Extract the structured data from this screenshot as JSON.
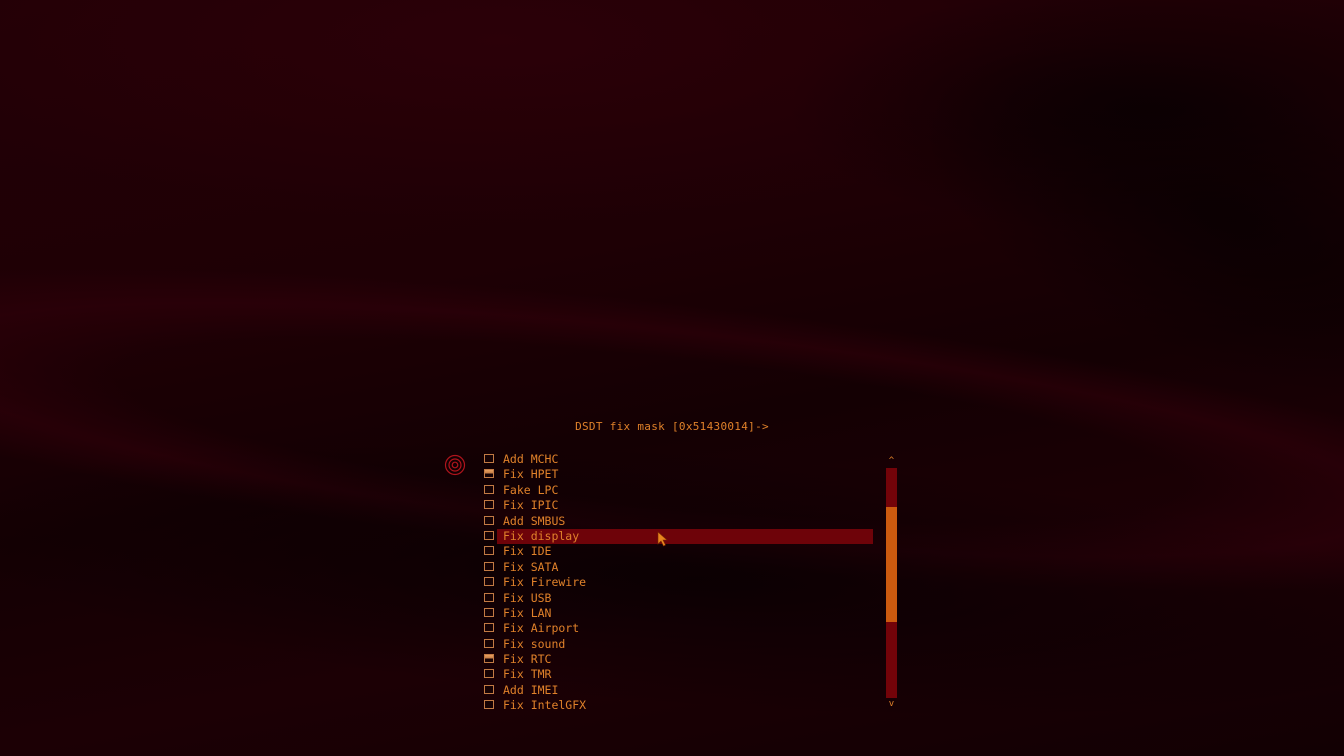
{
  "title": "DSDT fix mask [0x51430014]->",
  "menu": {
    "selected_index": 5,
    "items": [
      {
        "label": "Add MCHC",
        "checked": false
      },
      {
        "label": "Fix HPET",
        "checked": true
      },
      {
        "label": "Fake LPC",
        "checked": false
      },
      {
        "label": "Fix IPIC",
        "checked": false
      },
      {
        "label": "Add SMBUS",
        "checked": false
      },
      {
        "label": "Fix display",
        "checked": false
      },
      {
        "label": "Fix IDE",
        "checked": false
      },
      {
        "label": "Fix SATA",
        "checked": false
      },
      {
        "label": "Fix Firewire",
        "checked": false
      },
      {
        "label": "Fix USB",
        "checked": false
      },
      {
        "label": "Fix LAN",
        "checked": false
      },
      {
        "label": "Fix Airport",
        "checked": false
      },
      {
        "label": "Fix sound",
        "checked": false
      },
      {
        "label": "Fix RTC",
        "checked": true
      },
      {
        "label": "Fix TMR",
        "checked": false
      },
      {
        "label": "Add IMEI",
        "checked": false
      },
      {
        "label": "Fix IntelGFX",
        "checked": false
      }
    ]
  },
  "scrollbar": {
    "up_glyph": "^",
    "down_glyph": "v",
    "thumb_start_fraction": 0.17,
    "thumb_size_fraction": 0.5
  },
  "colors": {
    "text": "#e0812a",
    "selection": "#6e0309",
    "scroll_track": "#730309",
    "scroll_thumb": "#cc5a0f",
    "background": "#1a0004"
  },
  "icons": {
    "menu": "target-icon",
    "pointer": "mouse-pointer-icon"
  }
}
